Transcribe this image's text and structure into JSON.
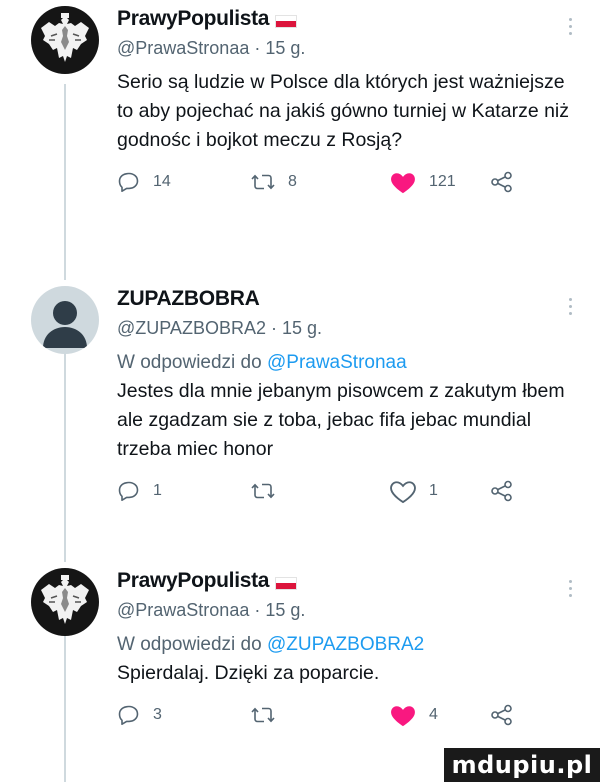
{
  "tweets": [
    {
      "author_name": "PrawyPopulista",
      "handle": "@PrawaStronaa · 15 g.",
      "avatar": "eagle-emblem",
      "text": "Serio są ludzie w Polsce dla których jest ważniejsze to aby pojechać na jakiś gówno turniej w Katarze niż godnośc i bojkot meczu z Rosją?",
      "reply_count": "14",
      "retweet_count": "8",
      "like_count": "121",
      "liked": true
    },
    {
      "author_name": "ZUPAZBOBRA",
      "handle": "@ZUPAZBOBRA2 · 15 g.",
      "avatar": "default-profile",
      "reply_prefix": "W odpowiedzi do",
      "reply_to": "@PrawaStronaa",
      "text": "Jestes dla mnie jebanym pisowcem z zakutym łbem ale zgadzam sie z toba, jebac fifa jebac mundial trzeba miec honor",
      "reply_count": "1",
      "retweet_count": "",
      "like_count": "1",
      "liked": false
    },
    {
      "author_name": "PrawyPopulista",
      "handle": "@PrawaStronaa · 15 g.",
      "avatar": "eagle-emblem",
      "reply_prefix": "W odpowiedzi do",
      "reply_to": "@ZUPAZBOBRA2",
      "text": "Spierdalaj. Dzięki za poparcie.",
      "reply_count": "3",
      "retweet_count": "",
      "like_count": "4",
      "liked": true
    }
  ],
  "watermark": "mdupiu.pl",
  "colors": {
    "text": "#0f1419",
    "muted": "#536471",
    "link": "#1d9bf0",
    "like": "#f91880",
    "thread_line": "#cfd9de",
    "flag_red": "#dc143c"
  }
}
